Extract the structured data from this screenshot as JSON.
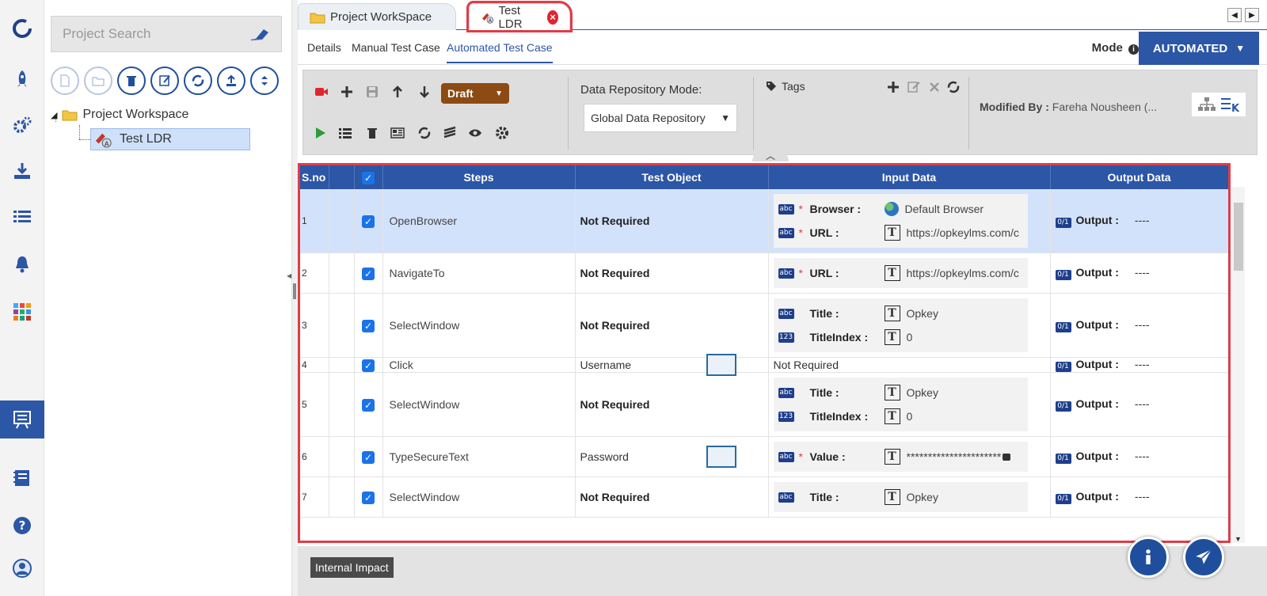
{
  "sidebar": {
    "search_placeholder": "Project Search",
    "tree": {
      "root_label": "Project Workspace",
      "child_label": "Test LDR"
    }
  },
  "doc_tabs": [
    {
      "label": "Project WorkSpace"
    },
    {
      "label": "Test LDR"
    }
  ],
  "sub_tabs": [
    {
      "label": "Details"
    },
    {
      "label": "Manual Test Case"
    },
    {
      "label": "Automated Test Case"
    }
  ],
  "mode": {
    "label": "Mode",
    "value": "AUTOMATED"
  },
  "toolbar": {
    "status": "Draft",
    "data_repo_label": "Data Repository Mode:",
    "data_repo_value": "Global Data Repository",
    "tags_label": "Tags",
    "modified_by_label": "Modified By :",
    "modified_by_value": "Fareha Nousheen (..."
  },
  "grid": {
    "columns": [
      "S.no",
      "",
      "Steps",
      "Test Object",
      "Input Data",
      "Output Data"
    ],
    "rows": [
      {
        "sno": "1",
        "step": "OpenBrowser",
        "object": "Not Required",
        "object_bold": true,
        "inputs": [
          {
            "type": "abc",
            "required": true,
            "name": "Browser :",
            "kind": "globe",
            "value": "Default Browser"
          },
          {
            "type": "abc",
            "required": true,
            "name": "URL :",
            "kind": "T",
            "value": "https://opkeylms.com/c"
          }
        ],
        "output_badge": "0/1",
        "output_label": "Output :",
        "output_value": "----"
      },
      {
        "sno": "2",
        "step": "NavigateTo",
        "object": "Not Required",
        "object_bold": true,
        "inputs": [
          {
            "type": "abc",
            "required": true,
            "name": "URL :",
            "kind": "T",
            "value": "https://opkeylms.com/c"
          }
        ],
        "output_badge": "0/1",
        "output_label": "Output :",
        "output_value": "----"
      },
      {
        "sno": "3",
        "step": "SelectWindow",
        "object": "Not Required",
        "object_bold": true,
        "inputs": [
          {
            "type": "abc",
            "required": false,
            "name": "Title :",
            "kind": "T",
            "value": "Opkey"
          },
          {
            "type": "123",
            "required": false,
            "name": "TitleIndex :",
            "kind": "T",
            "value": "0"
          }
        ],
        "output_badge": "0/1",
        "output_label": "Output :",
        "output_value": "----"
      },
      {
        "sno": "4",
        "step": "Click",
        "object": "Username",
        "object_bold": false,
        "thumb": true,
        "input_text": "Not Required",
        "output_badge": "0/1",
        "output_label": "Output :",
        "output_value": "----"
      },
      {
        "sno": "5",
        "step": "SelectWindow",
        "object": "Not Required",
        "object_bold": true,
        "inputs": [
          {
            "type": "abc",
            "required": false,
            "name": "Title :",
            "kind": "T",
            "value": "Opkey"
          },
          {
            "type": "123",
            "required": false,
            "name": "TitleIndex :",
            "kind": "T",
            "value": "0"
          }
        ],
        "output_badge": "0/1",
        "output_label": "Output :",
        "output_value": "----"
      },
      {
        "sno": "6",
        "step": "TypeSecureText",
        "object": "Password",
        "object_bold": false,
        "thumb": true,
        "inputs": [
          {
            "type": "abc",
            "required": true,
            "name": "Value :",
            "kind": "T",
            "value": "**********************",
            "lock": true
          }
        ],
        "output_badge": "0/1",
        "output_label": "Output :",
        "output_value": "----"
      },
      {
        "sno": "7",
        "step": "SelectWindow",
        "object": "Not Required",
        "object_bold": true,
        "inputs": [
          {
            "type": "abc",
            "required": false,
            "name": "Title :",
            "kind": "T",
            "value": "Opkey"
          }
        ],
        "output_badge": "0/1",
        "output_label": "Output :",
        "output_value": "----"
      }
    ]
  },
  "bottom": {
    "internal_impact": "Internal Impact"
  },
  "colors": {
    "primary": "#2c56a6",
    "highlight": "#e23b46",
    "draft": "#8c4b13",
    "selected_row": "#d3e2fb"
  }
}
